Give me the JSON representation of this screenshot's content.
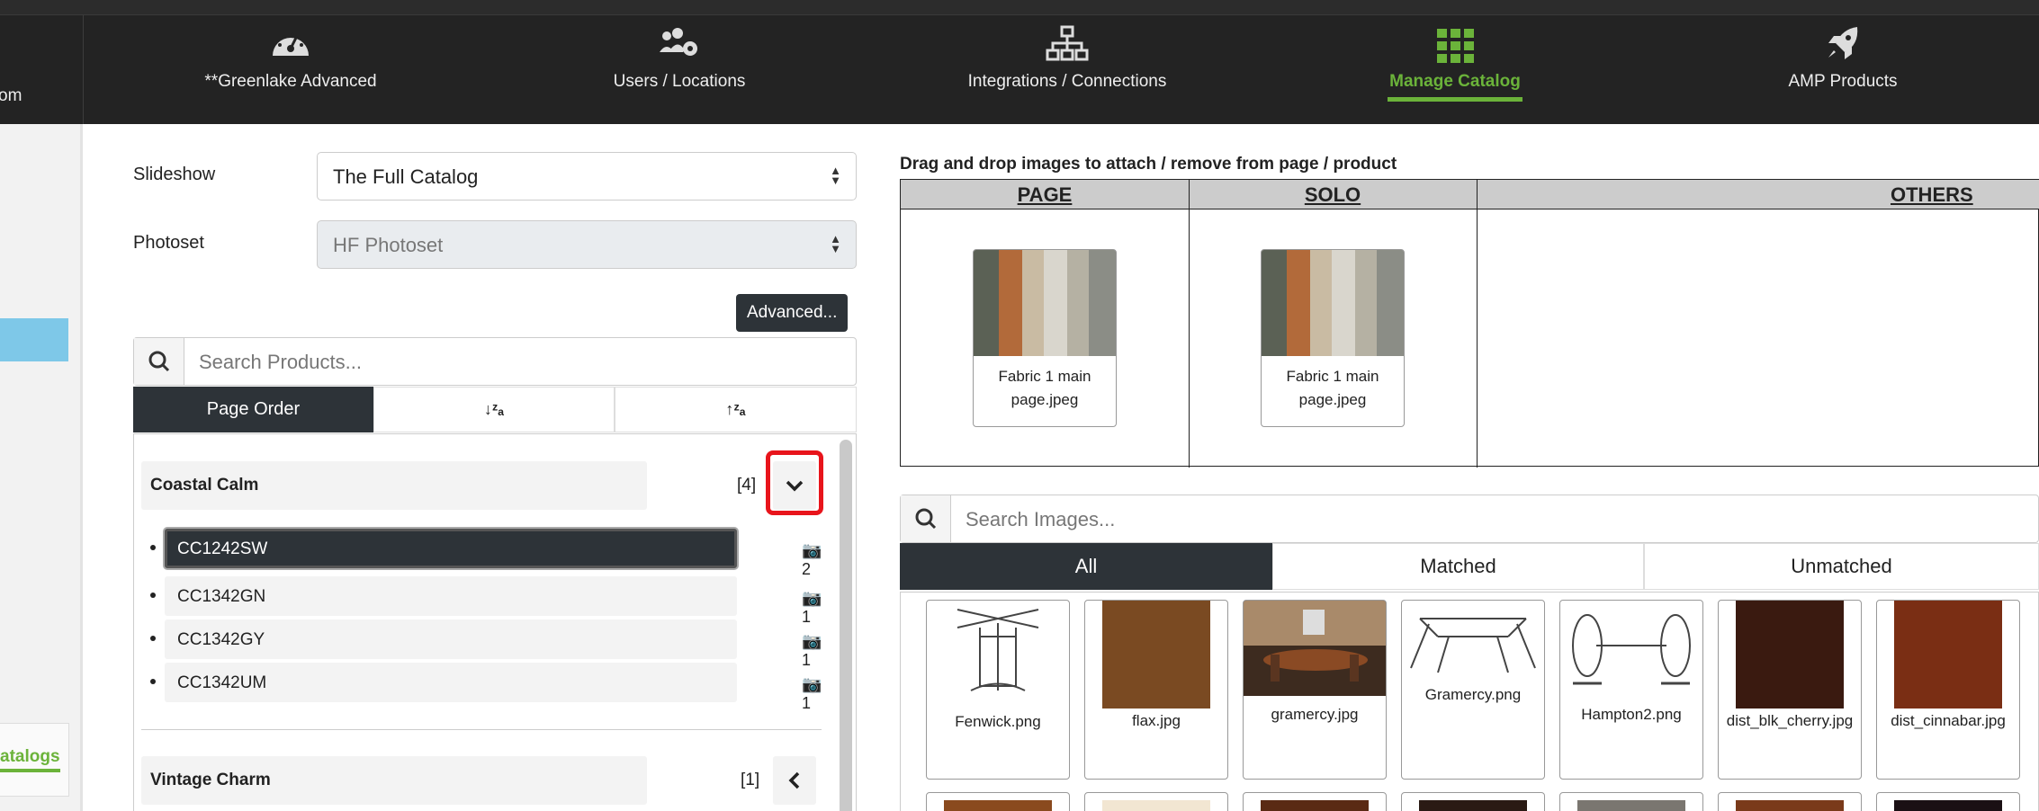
{
  "nav": {
    "partial_left": "om",
    "items": [
      {
        "label": "**Greenlake Advanced",
        "icon": "dashboard-icon"
      },
      {
        "label": "Users / Locations",
        "icon": "users-gear-icon"
      },
      {
        "label": "Integrations / Connections",
        "icon": "network-icon"
      },
      {
        "label": "Manage Catalog",
        "icon": "grid-icon",
        "active": true
      },
      {
        "label": "AMP Products",
        "icon": "rocket-icon"
      }
    ]
  },
  "sidebar": {
    "catalogs_label": "atalogs"
  },
  "form": {
    "slideshow_label": "Slideshow",
    "slideshow_value": "The Full Catalog",
    "photoset_label": "Photoset",
    "photoset_value": "HF Photoset",
    "advanced_button": "Advanced..."
  },
  "product_search": {
    "placeholder": "Search Products..."
  },
  "sort_tabs": {
    "page_order": "Page Order",
    "az_icon": "sort-alpha-down-icon",
    "za_icon": "sort-alpha-up-icon"
  },
  "groups": [
    {
      "name": "Coastal Calm",
      "count": "[4]",
      "expanded": true,
      "products": [
        {
          "code": "CC1242SW",
          "images": "2",
          "selected": true
        },
        {
          "code": "CC1342GN",
          "images": "1"
        },
        {
          "code": "CC1342GY",
          "images": "1"
        },
        {
          "code": "CC1342UM",
          "images": "1"
        }
      ]
    },
    {
      "name": "Vintage Charm",
      "count": "[1]",
      "expanded": false
    }
  ],
  "drag": {
    "title": "Drag and drop images to attach / remove from page / product",
    "columns": [
      "PAGE",
      "SOLO",
      "OTHERS"
    ],
    "page_thumb": "Fabric 1 main page.jpeg",
    "solo_thumb": "Fabric 1 main page.jpeg"
  },
  "image_search": {
    "placeholder": "Search Images..."
  },
  "image_tabs": [
    "All",
    "Matched",
    "Unmatched"
  ],
  "images": [
    "Fenwick.png",
    "flax.jpg",
    "gramercy.jpg",
    "Gramercy.png",
    "Hampton2.png",
    "dist_blk_cherry.jpg",
    "dist_cinnabar.jpg"
  ],
  "colors": {
    "accent": "#6bb33a",
    "dark": "#2d3338",
    "highlight_red": "#e8141b"
  }
}
